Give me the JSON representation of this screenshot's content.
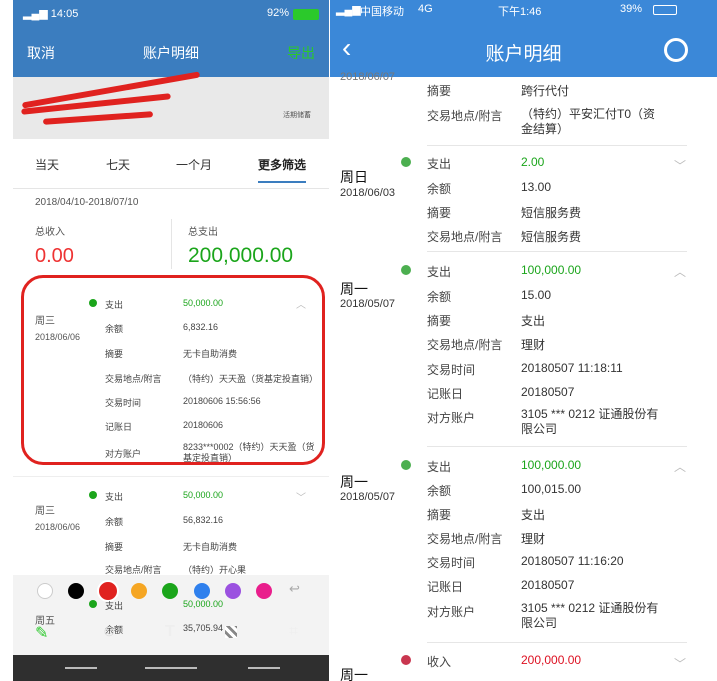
{
  "left": {
    "status": {
      "time": "14:05",
      "battery": "92%"
    },
    "nav": {
      "cancel": "取消",
      "title": "账户明细",
      "export": "导出"
    },
    "account_tag": "活期储蓄",
    "tabs": [
      "当天",
      "七天",
      "一个月",
      "更多筛选"
    ],
    "range": "2018/04/10-2018/07/10",
    "income_label": "总收入",
    "income": "0.00",
    "expense_label": "总支出",
    "expense": "200,000.00",
    "records": [
      {
        "day": "周三",
        "date": "2018/06/06",
        "type": "支出",
        "amount": "50,000.00",
        "rows": [
          [
            "余额",
            "6,832.16"
          ],
          [
            "摘要",
            "无卡自助消费"
          ],
          [
            "交易地点/附言",
            "（特约）天天盈（货基定投直销）"
          ],
          [
            "交易时间",
            "20180606 15:56:56"
          ],
          [
            "记账日",
            "20180606"
          ],
          [
            "对方账户",
            "8233***0002（特约）天天盈（货基定投直销）"
          ]
        ]
      },
      {
        "day": "周三",
        "date": "2018/06/06",
        "type": "支出",
        "amount": "50,000.00",
        "rows": [
          [
            "余额",
            "56,832.16"
          ],
          [
            "摘要",
            "无卡自助消费"
          ],
          [
            "交易地点/附言",
            "（特约）开心果"
          ]
        ]
      },
      {
        "day": "周五",
        "type": "支出",
        "amount": "50,000.00",
        "rows": [
          [
            "余额",
            "35,705.94"
          ]
        ]
      }
    ],
    "palette": [
      "#ffffff",
      "#000000",
      "#e0221f",
      "#f5a623",
      "#1ba51b",
      "#2f80ed",
      "#9b51e0",
      "#e91e8c"
    ]
  },
  "right": {
    "status": {
      "carrier": "中国移动",
      "net": "4G",
      "time": "下午1:46",
      "battery": "39%"
    },
    "nav": {
      "title": "账户明细"
    },
    "partial_date": "2018/06/07",
    "top_rows": [
      [
        "摘要",
        "跨行代付"
      ],
      [
        "交易地点/附言",
        "（特约）平安汇付T0（资金结算）"
      ]
    ],
    "records": [
      {
        "day": "周日",
        "date": "2018/06/03",
        "type": "支出",
        "amount": "2.00",
        "rows": [
          [
            "余额",
            "13.00"
          ],
          [
            "摘要",
            "短信服务费"
          ],
          [
            "交易地点/附言",
            "短信服务费"
          ]
        ]
      },
      {
        "day": "周一",
        "date": "2018/05/07",
        "type": "支出",
        "amount": "100,000.00",
        "rows": [
          [
            "余额",
            "15.00"
          ],
          [
            "摘要",
            "支出"
          ],
          [
            "交易地点/附言",
            "理财"
          ],
          [
            "交易时间",
            "20180507 11:18:11"
          ],
          [
            "记账日",
            "20180507"
          ],
          [
            "对方账户",
            "3105 *** 0212 证通股份有限公司"
          ]
        ]
      },
      {
        "day": "周一",
        "date": "2018/05/07",
        "type": "支出",
        "amount": "100,000.00",
        "rows": [
          [
            "余额",
            "100,015.00"
          ],
          [
            "摘要",
            "支出"
          ],
          [
            "交易地点/附言",
            "理财"
          ],
          [
            "交易时间",
            "20180507 11:16:20"
          ],
          [
            "记账日",
            "20180507"
          ],
          [
            "对方账户",
            "3105 *** 0212 证通股份有限公司"
          ]
        ]
      },
      {
        "day": "周一",
        "type": "收入",
        "amount": "200,000.00",
        "rows": []
      }
    ]
  }
}
